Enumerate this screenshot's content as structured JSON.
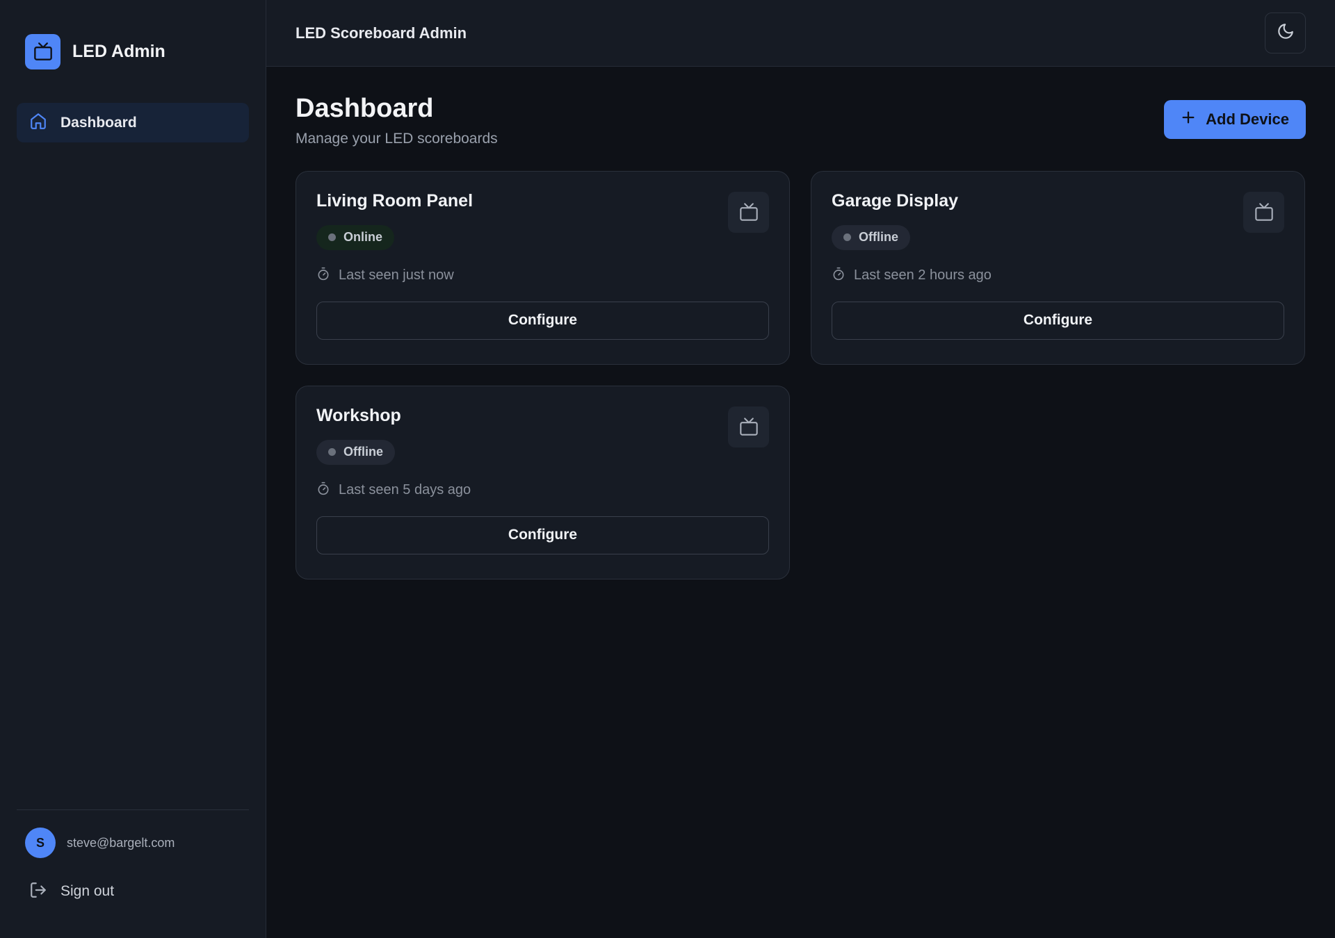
{
  "sidebar": {
    "brand_name": "LED Admin",
    "nav": [
      {
        "label": "Dashboard",
        "icon": "home-icon"
      }
    ],
    "user": {
      "initial": "S",
      "email": "steve@bargelt.com"
    },
    "signout_label": "Sign out"
  },
  "topbar": {
    "title": "LED Scoreboard Admin",
    "theme_icon": "moon-icon"
  },
  "page": {
    "title": "Dashboard",
    "subtitle": "Manage your LED scoreboards",
    "add_button_label": "Add Device"
  },
  "devices": [
    {
      "name": "Living Room Panel",
      "status": "Online",
      "last_seen": "Last seen just now",
      "action": "Configure"
    },
    {
      "name": "Garage Display",
      "status": "Offline",
      "last_seen": "Last seen 2 hours ago",
      "action": "Configure"
    },
    {
      "name": "Workshop",
      "status": "Offline",
      "last_seen": "Last seen 5 days ago",
      "action": "Configure"
    }
  ],
  "colors": {
    "accent": "#4f86f7",
    "background": "#0e1117",
    "surface": "#161b24"
  }
}
